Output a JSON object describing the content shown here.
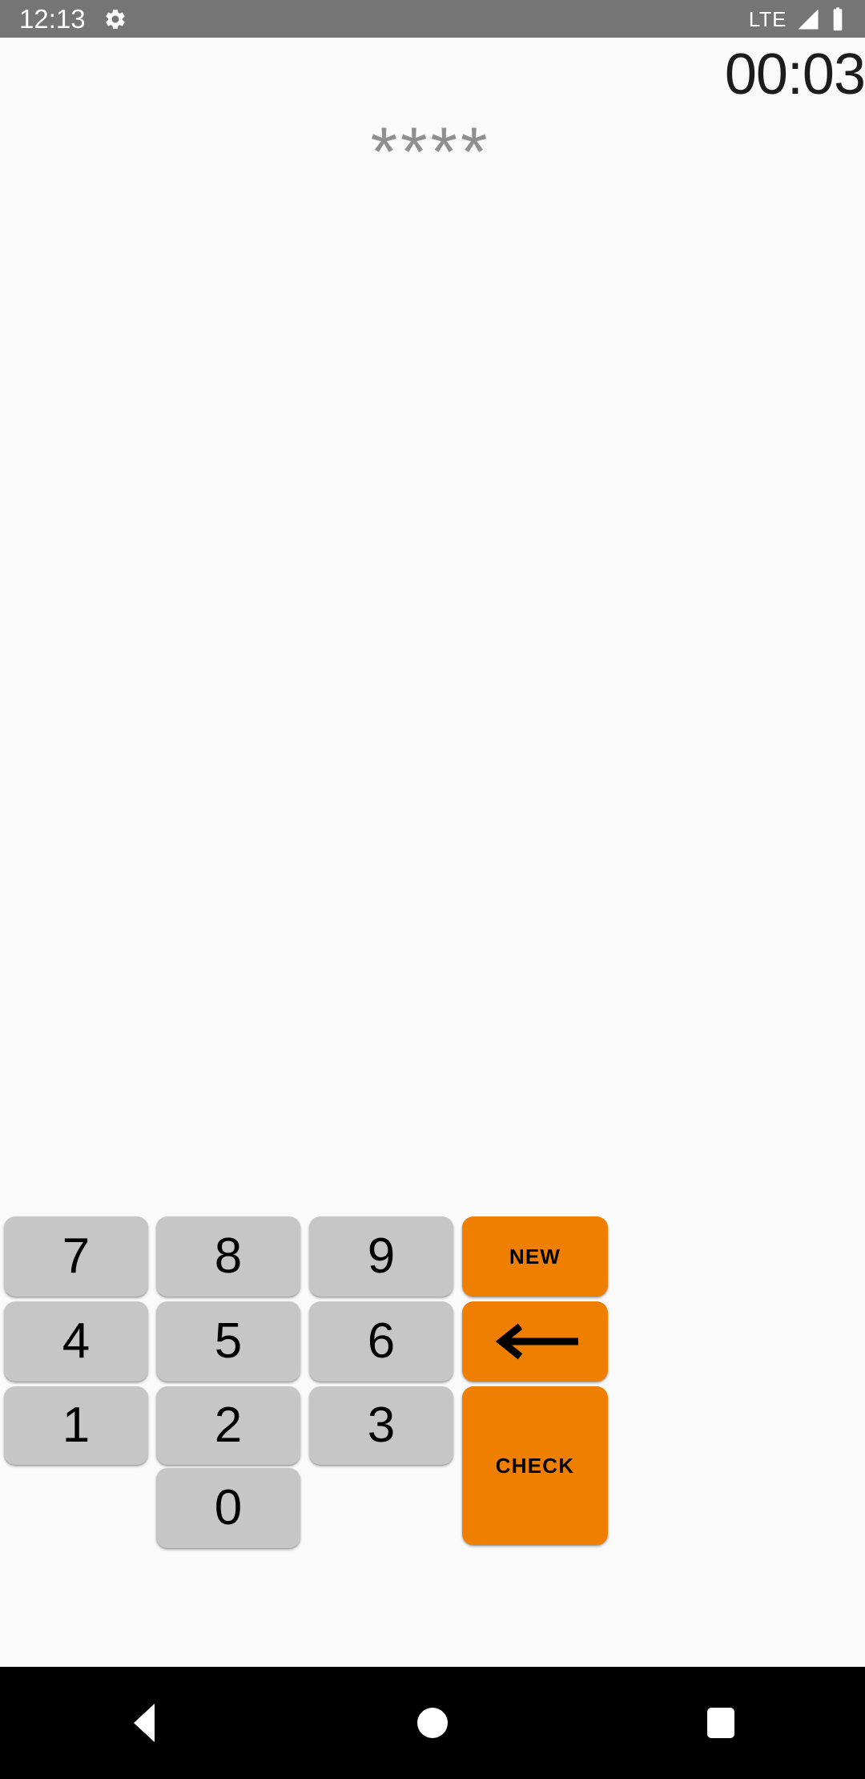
{
  "status_bar": {
    "clock": "12:13",
    "network_label": "LTE",
    "icons": [
      "gear-icon",
      "signal-icon",
      "battery-icon"
    ],
    "background_color": "#757575",
    "foreground_color": "#ffffff"
  },
  "game": {
    "timer": "00:03",
    "guess_display": "****",
    "guess_digits": 4,
    "mask_character": "*"
  },
  "keypad": {
    "rows": [
      {
        "keys": [
          {
            "label": "7",
            "name": "key-7",
            "type": "number"
          },
          {
            "label": "8",
            "name": "key-8",
            "type": "number"
          },
          {
            "label": "9",
            "name": "key-9",
            "type": "number"
          },
          {
            "label": "NEW",
            "name": "new-button",
            "type": "action"
          }
        ]
      },
      {
        "keys": [
          {
            "label": "4",
            "name": "key-4",
            "type": "number"
          },
          {
            "label": "5",
            "name": "key-5",
            "type": "number"
          },
          {
            "label": "6",
            "name": "key-6",
            "type": "number"
          },
          {
            "label": "",
            "name": "backspace-button",
            "type": "action",
            "icon": "arrow-left-icon"
          }
        ]
      },
      {
        "keys": [
          {
            "label": "1",
            "name": "key-1",
            "type": "number"
          },
          {
            "label": "2",
            "name": "key-2",
            "type": "number"
          },
          {
            "label": "3",
            "name": "key-3",
            "type": "number"
          },
          {
            "label": "CHECK",
            "name": "check-button",
            "type": "action"
          }
        ]
      },
      {
        "keys": [
          {
            "label": "0",
            "name": "key-0",
            "type": "number"
          }
        ]
      }
    ],
    "number_key_color": "#c6c6c6",
    "action_key_color": "#ee7f01",
    "key_text_color": "#000000"
  },
  "nav_bar": {
    "back_label": "Back",
    "home_label": "Home",
    "recents_label": "Recents",
    "background_color": "#000000"
  },
  "theme": {
    "page_background": "#fafafa",
    "accent": "#ee7f01",
    "mask_text_color": "#8f8f8f",
    "timer_text_color": "#1c1c1c"
  }
}
